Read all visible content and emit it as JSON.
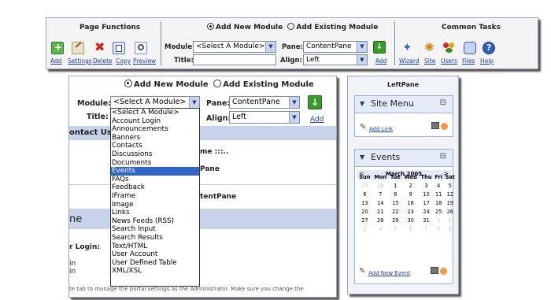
{
  "toolbar": {
    "page_functions_title": "Page Functions",
    "page_function_links": [
      "Add",
      "Settings",
      "Delete",
      "Copy",
      "Preview"
    ],
    "add_new_module": "Add New Module",
    "add_existing_module": "Add Existing Module",
    "module_label": "Module:",
    "module_select_value": "<Select A Module>",
    "pane_label": "Pane:",
    "pane_select_value": "ContentPane",
    "title_label": "Title:",
    "align_label": "Align:",
    "align_select_value": "Left",
    "add_link": "Add",
    "common_tasks_title": "Common Tasks",
    "common_task_links": [
      "Wizard",
      "Site",
      "Users",
      "Files",
      "Help"
    ]
  },
  "main": {
    "add_new_module": "Add New Module",
    "add_existing_module": "Add Existing Module",
    "module_label": "Module:",
    "module_select_value": "<Select A Module>",
    "pane_label": "Pane:",
    "pane_select_value": "ContentPane",
    "title_label": "Title:",
    "align_label": "Align:",
    "align_select_value": "Left",
    "add_link": "Add",
    "bg_fragments": [
      "ontact Us",
      "me :::..",
      "Pane",
      "tentPane",
      "ne",
      "r Login:",
      "in",
      "in",
      "te tab to manage the portal settings as the Administrator. Make sure you change the"
    ],
    "dropdown_options": [
      "<Select A Module>",
      "Account Login",
      "Announcements",
      "Banners",
      "Contacts",
      "Discussions",
      "Documents",
      "Events",
      "FAQs",
      "Feedback",
      "IFrame",
      "Image",
      "Links",
      "News Feeds (RSS)",
      "Search Input",
      "Search Results",
      "Text/HTML",
      "User Account",
      "User Defined Table",
      "XML/XSL"
    ],
    "dropdown_selected": "Events"
  },
  "leftpane": {
    "title": "LeftPane",
    "site_menu_title": "Site Menu",
    "add_link": "Add Link",
    "events_title": "Events",
    "add_event": "Add New Event",
    "calendar": {
      "month": "March 2005",
      "prev": "<",
      "next": ">",
      "days": [
        "Sun",
        "Mon",
        "Tue",
        "Wed",
        "Thu",
        "Fri",
        "Sat"
      ],
      "weeks": [
        [
          "27",
          "28",
          "1",
          "2",
          "3",
          "4",
          "5"
        ],
        [
          "6",
          "7",
          "8",
          "9",
          "10",
          "11",
          "12"
        ],
        [
          "13",
          "14",
          "15",
          "16",
          "17",
          "18",
          "19"
        ],
        [
          "20",
          "21",
          "22",
          "23",
          "24",
          "25",
          "26"
        ],
        [
          "27",
          "28",
          "29",
          "30",
          "31",
          "1",
          "2"
        ],
        [
          "3",
          "4",
          "5",
          "6",
          "7",
          "8",
          "9"
        ]
      ]
    }
  },
  "colors": {
    "link": "#1a3fb3",
    "highlight": "#3366cc",
    "header_bar": "#c6d3ea"
  }
}
